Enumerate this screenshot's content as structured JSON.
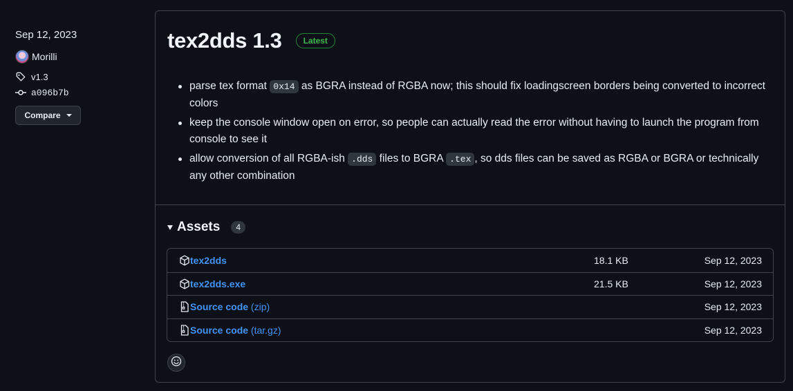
{
  "sidebar": {
    "date": "Sep 12, 2023",
    "author": "Morilli",
    "tag": "v1.3",
    "commit": "a096b7b",
    "compare_label": "Compare"
  },
  "release": {
    "title": "tex2dds 1.3",
    "badge": "Latest",
    "notes": [
      {
        "pre": "parse tex format ",
        "code": "0x14",
        "post": " as BGRA instead of RGBA now; this should fix loadingscreen borders being converted to incorrect colors"
      },
      {
        "text": "keep the console window open on error, so people can actually read the error without having to launch the program from console to see it"
      },
      {
        "pre": "allow conversion of all RGBA-ish ",
        "code": ".dds",
        "mid": " files to BGRA ",
        "code2": ".tex",
        "post": ", so dds files can be saved as RGBA or BGRA or technically any other combination"
      }
    ]
  },
  "assets": {
    "title": "Assets",
    "count": "4",
    "items": [
      {
        "name": "tex2dds",
        "suffix": "",
        "size": "18.1 KB",
        "date": "Sep 12, 2023",
        "icon": "package-icon"
      },
      {
        "name": "tex2dds.exe",
        "suffix": "",
        "size": "21.5 KB",
        "date": "Sep 12, 2023",
        "icon": "package-icon"
      },
      {
        "name": "Source code",
        "suffix": " (zip)",
        "size": "",
        "date": "Sep 12, 2023",
        "icon": "file-zip-icon"
      },
      {
        "name": "Source code",
        "suffix": " (tar.gz)",
        "size": "",
        "date": "Sep 12, 2023",
        "icon": "file-zip-icon"
      }
    ]
  },
  "colors": {
    "accent_link": "#4493f8",
    "latest_green": "#3fb950",
    "background": "#0d1117",
    "border": "#3d444d"
  }
}
